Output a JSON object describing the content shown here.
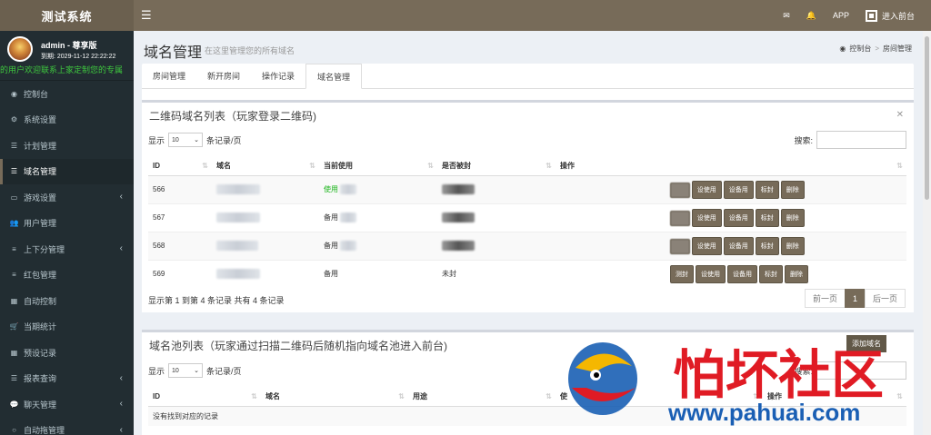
{
  "app": {
    "title": "测试系统",
    "menu_icon": "bars-icon"
  },
  "topbar": {
    "mail_icon": "envelope-icon",
    "bell_icon": "bell-icon",
    "app": "APP",
    "enter": "进入前台"
  },
  "user": {
    "name": "admin - 尊享版",
    "expire": "到期: 2029-11-12 22:22:22",
    "marquee": "的用户欢迎联系上家定制您的专属"
  },
  "nav": [
    {
      "label": "控制台",
      "icon": "dashboard-icon",
      "active": false,
      "chev": false
    },
    {
      "label": "系统设置",
      "icon": "cogs-icon",
      "active": false,
      "chev": false
    },
    {
      "label": "计划管理",
      "icon": "list-icon",
      "active": false,
      "chev": false
    },
    {
      "label": "域名管理",
      "icon": "list-icon",
      "active": true,
      "chev": false
    },
    {
      "label": "游戏设置",
      "icon": "gamepad-icon",
      "active": false,
      "chev": true
    },
    {
      "label": "用户管理",
      "icon": "users-icon",
      "active": false,
      "chev": false
    },
    {
      "label": "上下分管理",
      "icon": "database-icon",
      "active": false,
      "chev": true
    },
    {
      "label": "红包管理",
      "icon": "database-icon",
      "active": false,
      "chev": false
    },
    {
      "label": "自动控制",
      "icon": "table-icon",
      "active": false,
      "chev": false
    },
    {
      "label": "当期统计",
      "icon": "cart-icon",
      "active": false,
      "chev": false
    },
    {
      "label": "预设记录",
      "icon": "table-icon",
      "active": false,
      "chev": false
    },
    {
      "label": "报表查询",
      "icon": "list-icon",
      "active": false,
      "chev": true
    },
    {
      "label": "聊天管理",
      "icon": "comments-icon",
      "active": false,
      "chev": true
    },
    {
      "label": "自动拖管理",
      "icon": "comment-icon",
      "active": false,
      "chev": true
    }
  ],
  "page": {
    "title": "域名管理",
    "subtitle": "在这里管理您的所有域名",
    "crumb_home": "控制台",
    "crumb_current": "房间管理"
  },
  "tabs": [
    "房间管理",
    "新开房间",
    "操作记录",
    "域名管理"
  ],
  "box1": {
    "title": "二维码域名列表（玩家登录二维码)",
    "show": "显示",
    "len": "10",
    "per": "条记录/页",
    "search": "搜索:",
    "cols": [
      "ID",
      "域名",
      "当前使用",
      "是否被封",
      "操作"
    ],
    "rows": [
      {
        "id": "566",
        "use": "使用",
        "ban": "",
        "green": true
      },
      {
        "id": "567",
        "use": "备用",
        "ban": "",
        "green": false
      },
      {
        "id": "568",
        "use": "备用",
        "ban": "",
        "green": false
      },
      {
        "id": "569",
        "use": "备用",
        "ban": "未封",
        "green": false
      }
    ],
    "btns": [
      "测封",
      "设使用",
      "设备用",
      "标封",
      "删除"
    ],
    "info": "显示第 1 到第 4 条记录 共有 4 条记录",
    "prev": "前一页",
    "page": "1",
    "next": "后一页"
  },
  "box2": {
    "title": "域名池列表（玩家通过扫描二维码后随机指向域名池进入前台)",
    "add": "添加域名",
    "show": "显示",
    "len": "10",
    "per": "条记录/页",
    "search": "搜索:",
    "cols": [
      "ID",
      "域名",
      "用途",
      "使",
      "操作"
    ],
    "empty": "没有找到对应的记录"
  },
  "watermark": {
    "cn": "怕坏社区",
    "url": "www.pahuai.com"
  }
}
